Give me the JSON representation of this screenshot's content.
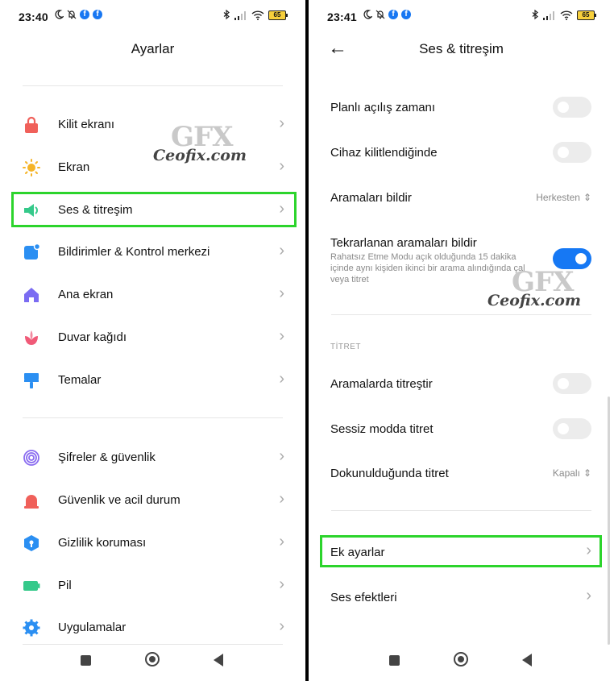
{
  "left": {
    "status": {
      "time": "23:40",
      "battery": "65"
    },
    "title": "Ayarlar",
    "items": [
      {
        "label": "Kilit ekranı"
      },
      {
        "label": "Ekran"
      },
      {
        "label": "Ses & titreşim"
      },
      {
        "label": "Bildirimler & Kontrol merkezi"
      },
      {
        "label": "Ana ekran"
      },
      {
        "label": "Duvar kağıdı"
      },
      {
        "label": "Temalar"
      },
      {
        "label": "Şifreler & güvenlik"
      },
      {
        "label": "Güvenlik ve acil durum"
      },
      {
        "label": "Gizlilik koruması"
      },
      {
        "label": "Pil"
      },
      {
        "label": "Uygulamalar"
      }
    ],
    "watermark": {
      "logo": "GFX",
      "site": "Ceofix.com"
    }
  },
  "right": {
    "status": {
      "time": "23:41",
      "battery": "65"
    },
    "title": "Ses & titreşim",
    "rows": {
      "planli": {
        "label": "Planlı açılış zamanı",
        "on": false
      },
      "cihaz": {
        "label": "Cihaz kilitlendiğinde",
        "on": false
      },
      "aramalari": {
        "label": "Aramaları bildir",
        "value": "Herkesten"
      },
      "tekrar": {
        "label": "Tekrarlanan aramaları bildir",
        "sub": "Rahatsız Etme Modu açık olduğunda 15 dakika içinde aynı kişiden ikinci bir arama alındığında çal veya titret",
        "on": true
      },
      "section": "TİTRET",
      "aramalarda": {
        "label": "Aramalarda titreştir",
        "on": false
      },
      "sessiz": {
        "label": "Sessiz modda titret",
        "on": false
      },
      "dokunul": {
        "label": "Dokunulduğunda titret",
        "value": "Kapalı"
      },
      "ek": {
        "label": "Ek ayarlar"
      },
      "efekt": {
        "label": "Ses efektleri"
      }
    },
    "watermark": {
      "logo": "GFX",
      "site": "Ceofix.com"
    }
  },
  "colors": {
    "highlight": "#2cd42c",
    "toggle_on": "#1678f4",
    "toggle_off": "#ececec"
  },
  "icons": [
    "lock-icon",
    "sun-icon",
    "speaker-icon",
    "notification-icon",
    "home-icon",
    "wallpaper-icon",
    "brush-icon",
    "fingerprint-icon",
    "alarm-icon",
    "shield-icon",
    "battery-icon",
    "gear-icon"
  ]
}
